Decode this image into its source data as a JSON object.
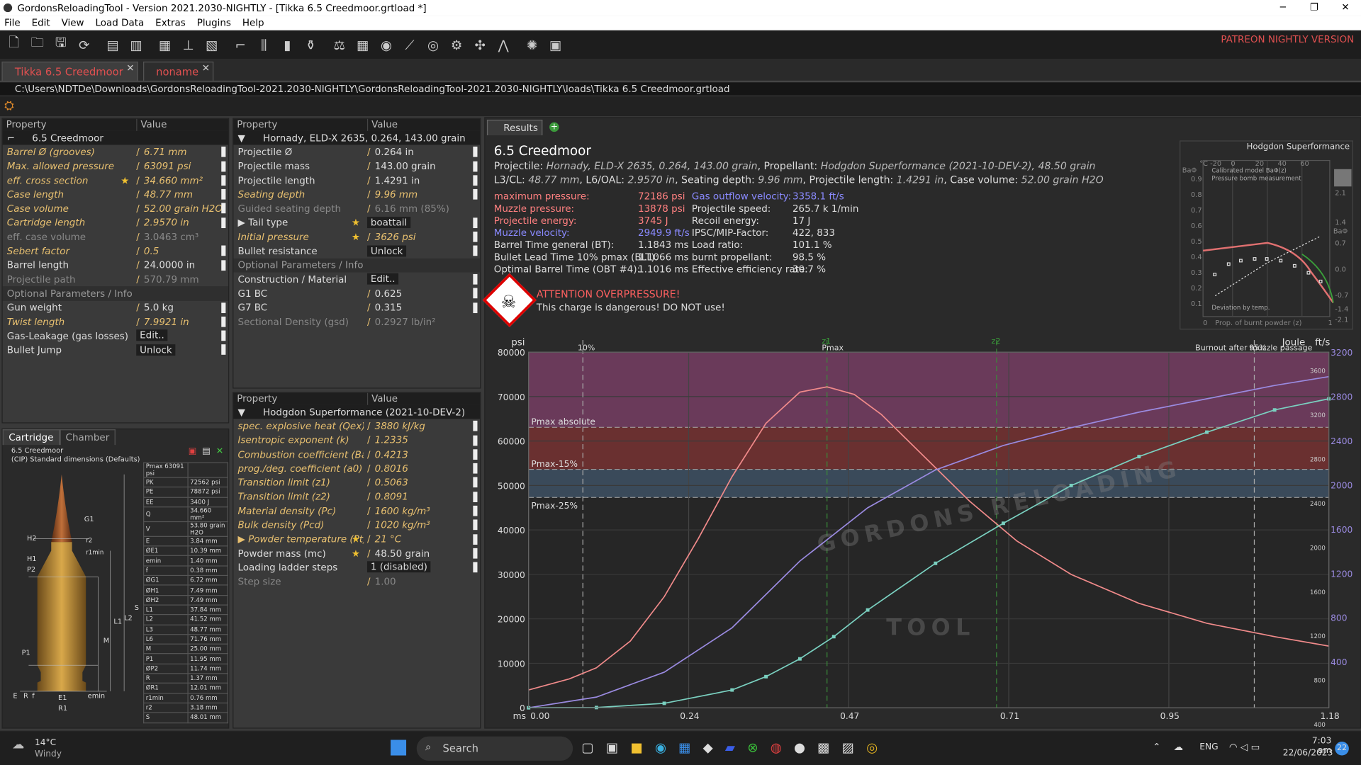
{
  "window": {
    "title": "GordonsReloadingTool - Version 2021.2030-NIGHTLY - [Tikka 6.5 Creedmoor.grtload *]",
    "min": "─",
    "max": "❐",
    "close": "✕"
  },
  "menu": [
    "File",
    "Edit",
    "View",
    "Load Data",
    "Extras",
    "Plugins",
    "Help"
  ],
  "patreon": "PATREON NIGHTLY VERSION",
  "tabs": [
    {
      "label": "Tikka 6.5 Creedmoor",
      "close": "✕"
    },
    {
      "label": "noname",
      "close": "✕"
    }
  ],
  "path": "C:\\Users\\NDTDe\\Downloads\\GordonsReloadingTool-2021.2030-NIGHTLY\\GordonsReloadingTool-2021.2030-NIGHTLY\\loads\\Tikka 6.5 Creedmoor.grtload",
  "headers": {
    "property": "Property",
    "value": "Value"
  },
  "cartridge": {
    "title": "6.5 Creedmoor",
    "rows": [
      {
        "k": "Barrel Ø (grooves)",
        "v": "6.71 mm",
        "s": "it"
      },
      {
        "k": "Max. allowed pressure",
        "v": "63091 psi",
        "s": "it"
      },
      {
        "k": "eff. cross section",
        "v": "34.660 mm²",
        "s": "it",
        "star": true
      },
      {
        "k": "Case length",
        "v": "48.77 mm",
        "s": "it"
      },
      {
        "k": "Case volume",
        "v": "52.00 grain H2O",
        "s": "it"
      },
      {
        "k": "Cartridge length",
        "v": "2.9570 in",
        "s": "it"
      },
      {
        "k": "eff. case volume",
        "v": "3.0463 cm³",
        "s": "dim"
      },
      {
        "k": "Sebert factor",
        "v": "0.5",
        "s": "it"
      },
      {
        "k": "Barrel length",
        "v": "24.0000 in",
        "s": "norm"
      },
      {
        "k": "Projectile path",
        "v": "570.79 mm",
        "s": "dim"
      }
    ],
    "opt_title": "Optional Parameters / Info",
    "opt": [
      {
        "k": "Gun weight",
        "v": "5.0 kg",
        "s": "norm"
      },
      {
        "k": "Twist length",
        "v": "7.9921 in",
        "s": "it"
      },
      {
        "k": "Gas-Leakage (gas losses)",
        "v": "Edit..",
        "s": "norm",
        "btn": true
      },
      {
        "k": "Bullet Jump",
        "v": "Unlock",
        "s": "norm",
        "btn": true
      }
    ]
  },
  "projectile": {
    "title": "Hornady, ELD-X 2635, 0.264, 143.00 grain",
    "rows": [
      {
        "k": "Projectile Ø",
        "v": "0.264 in",
        "s": "norm"
      },
      {
        "k": "Projectile mass",
        "v": "143.00 grain",
        "s": "norm"
      },
      {
        "k": "Projectile length",
        "v": "1.4291 in",
        "s": "norm"
      },
      {
        "k": "Seating depth",
        "v": "9.96 mm",
        "s": "it"
      },
      {
        "k": "Guided seating depth",
        "v": "6.16 mm (85%)",
        "s": "dim"
      },
      {
        "k": "▶ Tail type",
        "v": "boattail",
        "s": "norm",
        "btn": true,
        "star": true
      },
      {
        "k": "Initial pressure",
        "v": "3626 psi",
        "s": "it",
        "star": true
      },
      {
        "k": "Bullet resistance",
        "v": "Unlock",
        "s": "norm",
        "btn": true
      }
    ],
    "opt_title": "Optional Parameters / Info",
    "opt": [
      {
        "k": "Construction / Material",
        "v": "Edit..",
        "s": "norm",
        "btn": true
      },
      {
        "k": "G1 BC",
        "v": "0.625",
        "s": "norm"
      },
      {
        "k": "G7 BC",
        "v": "0.315",
        "s": "norm"
      },
      {
        "k": "Sectional Density (gsd)",
        "v": "0.2927 lb/in²",
        "s": "dim"
      }
    ]
  },
  "propellant": {
    "title": "Hodgdon Superformance (2021-10-DEV-2)",
    "rows": [
      {
        "k": "spec. explosive heat (Qex)",
        "v": "3880 kJ/kg",
        "s": "it"
      },
      {
        "k": "Isentropic exponent (k)",
        "v": "1.2335",
        "s": "it"
      },
      {
        "k": "Combustion coefficient (Ba)",
        "v": "0.4213",
        "s": "it"
      },
      {
        "k": "prog./deg. coefficient (a0)",
        "v": "0.8016",
        "s": "it"
      },
      {
        "k": "Transition limit (z1)",
        "v": "0.5063",
        "s": "it"
      },
      {
        "k": "Transition limit (z2)",
        "v": "0.8091",
        "s": "it"
      },
      {
        "k": "Material density (Pc)",
        "v": "1600 kg/m³",
        "s": "it"
      },
      {
        "k": "Bulk density (Pcd)",
        "v": "1020 kg/m³",
        "s": "it"
      },
      {
        "k": "▶ Powder temperature (Pt)",
        "v": "21 °C",
        "s": "it",
        "star": true
      },
      {
        "k": "Powder mass (mc)",
        "v": "48.50 grain",
        "s": "norm",
        "star": true
      },
      {
        "k": "Loading ladder steps",
        "v": "1 (disabled)",
        "s": "norm",
        "btn": true
      },
      {
        "k": "Step size",
        "v": "1.00",
        "s": "dim"
      }
    ]
  },
  "subtabs": [
    "Cartridge",
    "Chamber"
  ],
  "drawing": {
    "title": "6.5 Creedmoor",
    "subtitle": "(CIP) Standard dimensions (Defaults)",
    "dims": [
      [
        "Pmax 63091 psi",
        ""
      ],
      [
        "PK",
        "72562 psi"
      ],
      [
        "PE",
        "78872 psi"
      ],
      [
        "EE",
        "3400 J"
      ],
      [
        "Q",
        "34.660 mm²"
      ],
      [
        "V",
        "53.80 grain H2O"
      ],
      [
        "E",
        "3.84 mm"
      ],
      [
        "ØE1",
        "10.39 mm"
      ],
      [
        "emin",
        "1.40 mm"
      ],
      [
        "f",
        "0.38 mm"
      ],
      [
        "ØG1",
        "6.72 mm"
      ],
      [
        "ØH1",
        "7.49 mm"
      ],
      [
        "ØH2",
        "7.49 mm"
      ],
      [
        "L1",
        "37.84 mm"
      ],
      [
        "L2",
        "41.52 mm"
      ],
      [
        "L3",
        "48.77 mm"
      ],
      [
        "L6",
        "71.76 mm"
      ],
      [
        "M",
        "25.00 mm"
      ],
      [
        "P1",
        "11.95 mm"
      ],
      [
        "ØP2",
        "11.74 mm"
      ],
      [
        "R",
        "1.37 mm"
      ],
      [
        "ØR1",
        "12.01 mm"
      ],
      [
        "r1min",
        "0.76 mm"
      ],
      [
        "r2",
        "3.18 mm"
      ],
      [
        "S",
        "48.01 mm"
      ]
    ],
    "labels": {
      "g1": "G1",
      "h2": "H2",
      "h1": "H1",
      "p2": "P2",
      "r2": "r2",
      "r1min": "r1min",
      "l1": "L1",
      "l2": "L2",
      "s": "S",
      "m": "M",
      "p1": "P1",
      "e": "E",
      "r": "R",
      "f": "f",
      "e1": "E1",
      "emin": "emin",
      "r1": "R1"
    }
  },
  "results": {
    "tab": "Results",
    "title": "6.5 Creedmoor",
    "line1_a": "Projectile:",
    "line1_b": "Hornady, ELD-X 2635, 0.264, 143.00 grain",
    "line1_c": ", Propellant:",
    "line1_d": "Hodgdon Superformance (2021-10-DEV-2), 48.50 grain",
    "line2_a": "L3/CL:",
    "line2_b": "48.77 mm",
    "line2_c": ", L6/OAL:",
    "line2_d": "2.9570 in",
    "line2_e": ", Seating depth:",
    "line2_f": "9.96 mm",
    "line2_g": ", Projectile length:",
    "line2_h": "1.4291 in",
    "line2_i": ", Case volume:",
    "line2_j": "52.00 grain H2O",
    "col1": [
      {
        "k": "maximum pressure:",
        "v": "72186 psi",
        "c": "#ff8080"
      },
      {
        "k": "Muzzle pressure:",
        "v": "13878 psi",
        "c": "#ff8080"
      },
      {
        "k": "Projectile energy:",
        "v": "3745 J",
        "c": "#ff8080"
      },
      {
        "k": "Muzzle velocity:",
        "v": "2949.9 ft/s",
        "c": "#8a8aff"
      },
      {
        "k": "Barrel Time general (BT):",
        "v": "1.1843 ms",
        "c": "#ddd"
      },
      {
        "k": "Bullet Lead Time 10% pmax (BLT):",
        "v": "1.1066 ms",
        "c": "#ddd"
      },
      {
        "k": "Optimal Barrel Time (OBT #4):",
        "v": "1.1016 ms",
        "c": "#ddd"
      }
    ],
    "col2": [
      {
        "k": "Gas outflow velocity:",
        "v": "3358.1 ft/s",
        "c": "#8a8aff"
      },
      {
        "k": "Projectile speed:",
        "v": "265.7 k 1/min",
        "c": "#ddd"
      },
      {
        "k": "Recoil energy:",
        "v": "17 J",
        "c": "#ddd"
      },
      {
        "k": "IPSC/MIP-Factor:",
        "v": "422, 833",
        "c": "#ddd"
      },
      {
        "k": "Load ratio:",
        "v": "101.1 %",
        "c": "#ddd"
      },
      {
        "k": "burnt propellant:",
        "v": "98.5 %",
        "c": "#ddd"
      },
      {
        "k": "Effective efficiency rate:",
        "v": "30.7 %",
        "c": "#ddd"
      }
    ],
    "warn_title": "ATTENTION OVERPRESSURE!",
    "warn_text": "This charge is dangerous! DO NOT use!",
    "mini": {
      "title": "Hodgdon Superformance",
      "ba": "BaΦ",
      "ba2": "BaΦ",
      "top_ticks": [
        "°C -20",
        "0",
        "20",
        "40",
        "60"
      ],
      "left_ticks": [
        "0.9",
        "0.8",
        "0.7",
        "0.6",
        "0.5",
        "0.4",
        "0.3",
        "0.2",
        "0.1"
      ],
      "right_ticks": [
        "2.1",
        "1.4",
        "0.7",
        "0.0",
        "-0.7",
        "-1.4",
        "-2.1"
      ],
      "leg1": "Calibrated model BaΦ(z)",
      "leg2": "Pressure bomb measurement",
      "leg3": "Deviation by temp.",
      "xlabel": "Prop. of burnt powder (z)",
      "x0": "0",
      "x1": "1"
    }
  },
  "chart_data": {
    "type": "line",
    "x_label": "ms",
    "y_left_unit": "psi",
    "y_joule_unit": "Joule",
    "y_fts_unit": "ft/s",
    "xlim": [
      0,
      1.18
    ],
    "ylim_psi": [
      0,
      80000
    ],
    "x_ticks": [
      "0.00",
      "0.24",
      "0.47",
      "0.71",
      "0.95",
      "1.18"
    ],
    "y_ticks": [
      "80000",
      "70000",
      "60000",
      "50000",
      "40000",
      "30000",
      "20000",
      "10000",
      "0"
    ],
    "y_ticks_joule": [
      "3600",
      "3200",
      "2800",
      "2400",
      "2000",
      "1600",
      "1200",
      "800",
      "400"
    ],
    "y_ticks_fts": [
      "3200",
      "2800",
      "2400",
      "2000",
      "1600",
      "1200",
      "800",
      "400"
    ],
    "bands": [
      {
        "label": "Pmax absolute",
        "y": 63091
      },
      {
        "label": "Pmax-15%",
        "y": 53627
      },
      {
        "label": "Pmax-25%",
        "y": 47318
      }
    ],
    "markers": [
      {
        "label": "10%",
        "x": 0.08
      },
      {
        "label": "z1",
        "x": 0.44
      },
      {
        "label": "Pmax",
        "x": 0.44
      },
      {
        "label": "z2",
        "x": 0.69
      },
      {
        "label": "95%",
        "x": 1.07
      }
    ],
    "burnout": "Burnout after muzzle passage",
    "watermark_top": "GORDONS RELOADING",
    "watermark_bottom": "TOOL",
    "series": [
      {
        "name": "pressure",
        "color": "#f08a8a",
        "x": [
          0,
          0.06,
          0.1,
          0.15,
          0.2,
          0.25,
          0.3,
          0.35,
          0.4,
          0.44,
          0.48,
          0.52,
          0.58,
          0.65,
          0.72,
          0.8,
          0.9,
          1.0,
          1.1,
          1.18
        ],
        "y": [
          4000,
          6500,
          9000,
          15000,
          25000,
          38000,
          52000,
          64000,
          71000,
          72186,
          70500,
          66000,
          57000,
          46500,
          37500,
          30000,
          23500,
          19000,
          16000,
          13878
        ]
      },
      {
        "name": "velocity",
        "color": "#9a8ae0",
        "x": [
          0,
          0.1,
          0.2,
          0.3,
          0.4,
          0.5,
          0.6,
          0.7,
          0.8,
          0.9,
          1.0,
          1.1,
          1.18
        ],
        "y": [
          0,
          2400,
          8000,
          18000,
          33000,
          45000,
          53500,
          59000,
          63000,
          66500,
          69500,
          72500,
          74500
        ]
      },
      {
        "name": "burnt",
        "color": "#7ad0c0",
        "x": [
          0,
          0.1,
          0.2,
          0.3,
          0.35,
          0.4,
          0.45,
          0.5,
          0.6,
          0.7,
          0.8,
          0.9,
          1.0,
          1.1,
          1.18
        ],
        "y": [
          0,
          50,
          1000,
          4000,
          7000,
          11000,
          16000,
          22000,
          32500,
          41500,
          50000,
          56500,
          62000,
          67000,
          69500
        ]
      }
    ]
  },
  "taskbar": {
    "temp": "14°C",
    "weather": "Windy",
    "search": "Search",
    "lang": "ENG",
    "time": "7:03 am",
    "date": "22/06/2023",
    "notif": "22"
  }
}
